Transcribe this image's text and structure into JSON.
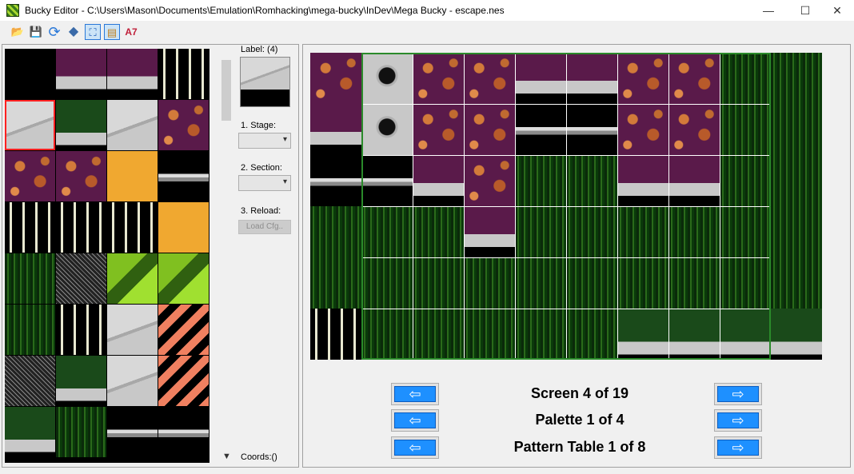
{
  "window": {
    "title": "Bucky Editor - C:\\Users\\Mason\\Documents\\Emulation\\Romhacking\\mega-bucky\\InDev\\Mega Bucky - escape.nes",
    "minimize": "—",
    "maximize": "☐",
    "close": "✕"
  },
  "toolbar": {
    "buttons": [
      {
        "name": "open-icon",
        "glyph": "📂"
      },
      {
        "name": "save-icon",
        "glyph": "💾"
      },
      {
        "name": "reload-icon",
        "glyph": "⟳"
      },
      {
        "name": "diamond-icon",
        "glyph": "◆"
      },
      {
        "name": "fullscreen-icon",
        "glyph": "⛶"
      },
      {
        "name": "notes-icon",
        "glyph": "▤"
      },
      {
        "name": "a7-label",
        "glyph": "A7"
      }
    ]
  },
  "side": {
    "label_title": "Label: (4)",
    "stage_label": "1. Stage:",
    "section_label": "2. Section:",
    "reload_label": "3. Reload:",
    "load_cfg_button": "Load Cfg..",
    "coords": "Coords:()"
  },
  "nav": {
    "screen": "Screen 4 of 19",
    "palette": "Palette 1 of 4",
    "pattern": "Pattern Table 1 of 8",
    "left_arrow": "⇦",
    "right_arrow": "⇨"
  }
}
